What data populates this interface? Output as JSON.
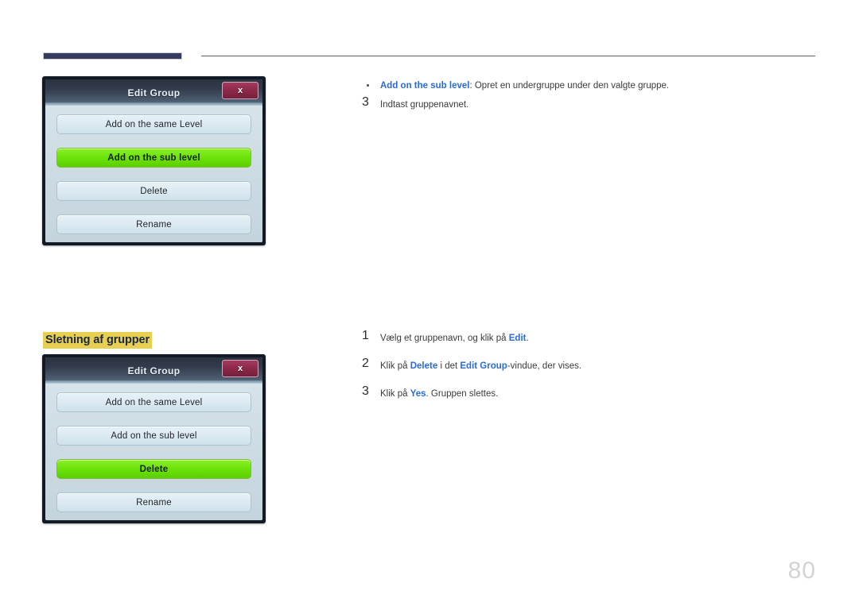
{
  "page": {
    "number": "80",
    "background": "#ffffff",
    "rule_color": "#363c5c"
  },
  "section": {
    "heading": "Sletning af grupper",
    "heading_highlight": "#e7cf51",
    "heading_color": "#1d2746"
  },
  "dialogs": [
    {
      "title": "Edit Group",
      "close_label": "x",
      "buttons": [
        {
          "label": "Add on the same Level",
          "selected": false
        },
        {
          "label": "Add on the sub level",
          "selected": true
        },
        {
          "label": "Delete",
          "selected": false
        },
        {
          "label": "Rename",
          "selected": false
        }
      ]
    },
    {
      "title": "Edit Group",
      "close_label": "x",
      "buttons": [
        {
          "label": "Add on the same Level",
          "selected": false
        },
        {
          "label": "Add on the sub level",
          "selected": false
        },
        {
          "label": "Delete",
          "selected": true
        },
        {
          "label": "Rename",
          "selected": false
        }
      ]
    }
  ],
  "top_text": {
    "bullet": {
      "keyword": "Add on the sub level",
      "rest": ": Opret en undergruppe under den valgte gruppe."
    },
    "step": {
      "number": "3",
      "text": "Indtast gruppenavnet."
    }
  },
  "bottom_steps": [
    {
      "number": "1",
      "pre": "Vælg et gruppenavn, og klik på ",
      "kw1": "Edit",
      "mid": ".",
      "kw2": "",
      "post": ""
    },
    {
      "number": "2",
      "pre": "Klik på ",
      "kw1": "Delete",
      "mid": " i det ",
      "kw2": "Edit Group",
      "post": "-vindue, der vises."
    },
    {
      "number": "3",
      "pre": "Klik på ",
      "kw1": "Yes",
      "mid": ". Gruppen slettes.",
      "kw2": "",
      "post": ""
    }
  ],
  "colors": {
    "accent_blue": "#2a6bd4",
    "selected_green": "#6fe40c",
    "close_red": "#8e2a4a",
    "titlebar_dark": "#2b3340"
  }
}
